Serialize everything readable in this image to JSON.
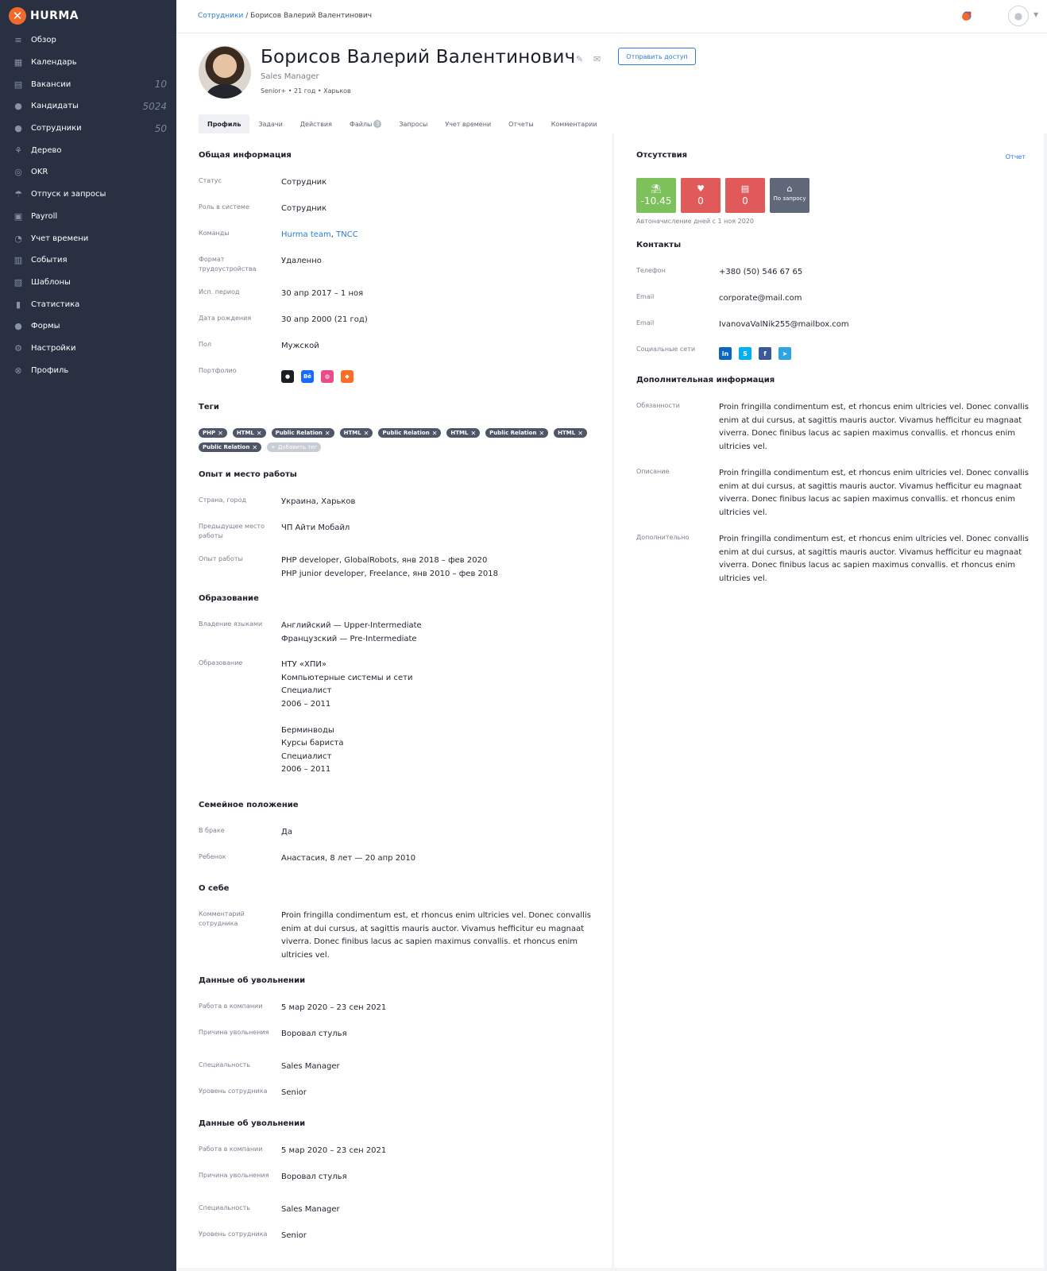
{
  "app": {
    "logo_text": "HURMA"
  },
  "sidebar": {
    "items": [
      {
        "label": "Обзор",
        "icon": "overview-icon",
        "glyph": "≡",
        "count": ""
      },
      {
        "label": "Календарь",
        "icon": "calendar-icon",
        "glyph": "▦",
        "count": ""
      },
      {
        "label": "Вакансии",
        "icon": "vacancies-icon",
        "glyph": "▤",
        "count": "10"
      },
      {
        "label": "Кандидаты",
        "icon": "candidates-icon",
        "glyph": "●",
        "count": "5024"
      },
      {
        "label": "Сотрудники",
        "icon": "employees-icon",
        "glyph": "●",
        "count": "50"
      },
      {
        "label": "Дерево",
        "icon": "tree-icon",
        "glyph": "⚘",
        "count": ""
      },
      {
        "label": "OKR",
        "icon": "okr-icon",
        "glyph": "◎",
        "count": ""
      },
      {
        "label": "Отпуск и запросы",
        "icon": "vacation-icon",
        "glyph": "☂",
        "count": ""
      },
      {
        "label": "Payroll",
        "icon": "payroll-icon",
        "glyph": "▣",
        "count": ""
      },
      {
        "label": "Учет времени",
        "icon": "timetracking-icon",
        "glyph": "◔",
        "count": ""
      },
      {
        "label": "События",
        "icon": "events-icon",
        "glyph": "▥",
        "count": ""
      },
      {
        "label": "Шаблоны",
        "icon": "templates-icon",
        "glyph": "▧",
        "count": ""
      },
      {
        "label": "Статистика",
        "icon": "statistics-icon",
        "glyph": "▮",
        "count": ""
      },
      {
        "label": "Формы",
        "icon": "forms-icon",
        "glyph": "●",
        "count": ""
      },
      {
        "label": "Настройки",
        "icon": "settings-icon",
        "glyph": "⚙",
        "count": ""
      },
      {
        "label": "Профиль",
        "icon": "profile-icon",
        "glyph": "⊗",
        "count": ""
      }
    ]
  },
  "breadcrumb": {
    "parent": "Сотрудники",
    "separator": " / ",
    "current": "Борисов Валерий Валентинович"
  },
  "profile": {
    "name": "Борисов Валерий Валентинович",
    "position": "Sales Manager",
    "meta": "Senior+ • 21 год • Харьков",
    "send_access": "Отправить доступ"
  },
  "tabs": [
    {
      "label": "Профиль",
      "badge": ""
    },
    {
      "label": "Задачи",
      "badge": ""
    },
    {
      "label": "Действия",
      "badge": ""
    },
    {
      "label": "Файлы",
      "badge": "3"
    },
    {
      "label": "Запросы",
      "badge": ""
    },
    {
      "label": "Учет времени",
      "badge": ""
    },
    {
      "label": "Отчеты",
      "badge": ""
    },
    {
      "label": "Комментарии",
      "badge": ""
    }
  ],
  "general": {
    "title": "Общая информация",
    "status_label": "Статус",
    "status": "Сотрудник",
    "role_label": "Роль в системе",
    "role": "Сотрудник",
    "teams_label": "Команды",
    "team1": "Hurma team",
    "team2": "TNCC",
    "format_label": "Формат трудоустройства",
    "format": "Удаленно",
    "probation_label": "Исп. период",
    "probation": "30 апр 2017 – 1 ноя",
    "birth_label": "Дата рождения",
    "birth": "30 апр 2000 (21 год)",
    "gender_label": "Пол",
    "gender": "Мужской",
    "portfolio_label": "Портфолио",
    "portfolio": [
      {
        "name": "github-icon",
        "glyph": "●",
        "color": "#1b1f23"
      },
      {
        "name": "behance-icon",
        "glyph": "Bē",
        "color": "#1769ff"
      },
      {
        "name": "dribbble-icon",
        "glyph": "◍",
        "color": "#ea4c89"
      },
      {
        "name": "gitlab-icon",
        "glyph": "◆",
        "color": "#fc6d26"
      }
    ]
  },
  "tags": {
    "title": "Теги",
    "items": [
      "PHP",
      "HTML",
      "Public Relation",
      "HTML",
      "Public Relation",
      "HTML",
      "Public Relation",
      "HTML",
      "Public Relation"
    ],
    "add": "Добавить тег"
  },
  "experience": {
    "title": "Опыт и место работы",
    "country_label": "Страна, город",
    "country": "Украина, Харьков",
    "prev_label": "Предыдущее место работы",
    "prev": "ЧП Айти Мобайл",
    "exp_label": "Опыт работы",
    "exp1": "PHP developer, GlobalRobots, янв 2018 – фев 2020",
    "exp2": "PHP junior developer, Freelance, янв 2010 – фев 2018"
  },
  "education": {
    "title": "Образование",
    "lang_label": "Владение языками",
    "lang1": "Английский — Upper-Intermediate",
    "lang2": "Французский — Pre-Intermediate",
    "edu_label": "Образование",
    "edu1": [
      "НТУ «ХПИ»",
      "Компьютерные системы и сети",
      "Специалист",
      "2006 – 2011"
    ],
    "edu2": [
      "Берминводы",
      "Курсы бариста",
      "Специалист",
      "2006 – 2011"
    ]
  },
  "family": {
    "title": "Семейное положение",
    "married_label": "В браке",
    "married": "Да",
    "child_label": "Ребенок",
    "child": "Анастасия, 8 лет — 20 апр 2010"
  },
  "about": {
    "title": "О себе",
    "comment_label": "Комментарий сотрудника",
    "comment": "Proin fringilla condimentum est, et rhoncus enim ultricies vel. Donec convallis enim at dui cursus, at sagittis mauris auctor. Vivamus hefficitur  eu magnaat viverra. Donec finibus lacus ac sapien maximus convallis. et rhoncus enim ultricies vel."
  },
  "dismissal": [
    {
      "title": "Данные об увольнении",
      "work_label": "Работа в компании",
      "work": "5 мар 2020 – 23 сен 2021",
      "reason_label": "Причина увольнения",
      "reason": "Воровал стулья",
      "spec_label": "Специальность",
      "spec": "Sales Manager",
      "level_label": "Уровень сотрудника",
      "level": "Senior"
    },
    {
      "title": "Данные об увольнении",
      "work_label": "Работа в компании",
      "work": "5 мар 2020 – 23 сен 2021",
      "reason_label": "Причина увольнения",
      "reason": "Воровал стулья",
      "spec_label": "Специальность",
      "spec": "Sales Manager",
      "level_label": "Уровень сотрудника",
      "level": "Senior"
    }
  ],
  "absences": {
    "title": "Отсутствия",
    "report": "Отчет",
    "vacation": {
      "value": "-10.45",
      "color": "#7dc15b"
    },
    "sick": {
      "value": "0",
      "color": "#e05a5a"
    },
    "unpaid": {
      "value": "0",
      "color": "#e05a5a"
    },
    "on_request": {
      "text": "По запросу",
      "color": "#5f6778"
    },
    "auto_note": "Автоначисление дней с 1 ноя 2020"
  },
  "contacts": {
    "title": "Контакты",
    "phone_label": "Телефон",
    "phone": "+380 (50) 546 67 65",
    "email1_label": "Email",
    "email1": "corporate@mail.com",
    "email2_label": "Email",
    "email2": "IvanovaValNik255@mailbox.com",
    "social_label": "Социальные сети",
    "social": [
      {
        "name": "linkedin-icon",
        "glyph": "in",
        "color": "#0a66c2"
      },
      {
        "name": "skype-icon",
        "glyph": "S",
        "color": "#00aff0"
      },
      {
        "name": "facebook-icon",
        "glyph": "f",
        "color": "#3b5998"
      },
      {
        "name": "telegram-icon",
        "glyph": "➤",
        "color": "#2ca5e0"
      }
    ]
  },
  "additional": {
    "title": "Дополнительная информация",
    "duties_label": "Обязанности",
    "duties": "Proin fringilla condimentum est, et rhoncus enim ultricies vel. Donec convallis enim at dui cursus, at sagittis mauris auctor. Vivamus hefficitur  eu magnaat viverra. Donec finibus lacus ac sapien maximus convallis. et rhoncus enim ultricies vel.",
    "desc_label": "Описание",
    "desc": "Proin fringilla condimentum est, et rhoncus enim ultricies vel. Donec convallis enim at dui cursus, at sagittis mauris auctor. Vivamus hefficitur  eu magnaat viverra. Donec finibus lacus ac sapien maximus convallis. et rhoncus enim ultricies vel.",
    "extra_label": "Дополнительно",
    "extra": "Proin fringilla condimentum est, et rhoncus enim ultricies vel. Donec convallis enim at dui cursus, at sagittis mauris auctor. Vivamus hefficitur  eu magnaat viverra. Donec finibus lacus ac sapien maximus convallis. et rhoncus enim ultricies vel."
  }
}
